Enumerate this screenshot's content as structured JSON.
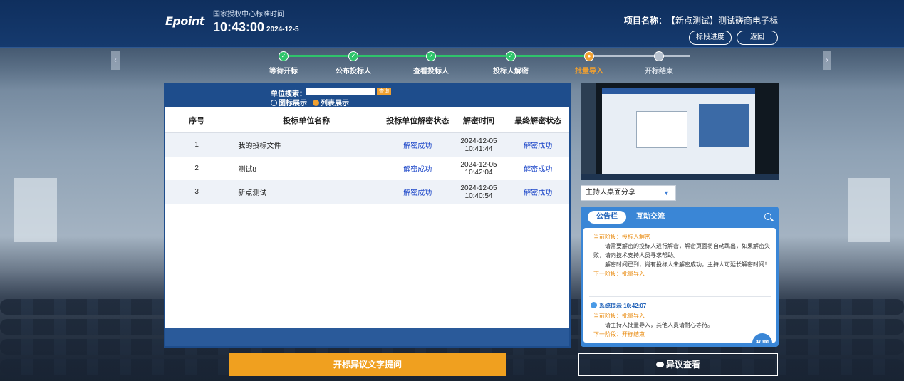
{
  "header": {
    "logo": "Epoint",
    "time_label": "国家授权中心标准时间",
    "time": "10:43:00",
    "date": "2024-12-5",
    "project_label": "项目名称：",
    "project_name": "【新点测试】测试磋商电子标",
    "btn_progress": "标段进度",
    "btn_back": "返回"
  },
  "steps": [
    {
      "label": "等待开标",
      "state": "done"
    },
    {
      "label": "公布投标人",
      "state": "done"
    },
    {
      "label": "查看投标人",
      "state": "done"
    },
    {
      "label": "投标人解密",
      "state": "done"
    },
    {
      "label": "批量导入",
      "state": "current"
    },
    {
      "label": "开标结束",
      "state": "pending"
    }
  ],
  "colors": {
    "done": "#2fc46b",
    "current": "#f0a030",
    "pending": "#b7c2cf"
  },
  "panel": {
    "search_label": "单位搜索：",
    "search_value": "",
    "search_btn": "查询",
    "radio_icon": "图标展示",
    "radio_list": "列表展示",
    "columns": [
      "序号",
      "投标单位名称",
      "投标单位解密状态",
      "解密时间",
      "最终解密状态"
    ],
    "rows": [
      {
        "no": "1",
        "name": "我的投标文件",
        "status": "解密成功",
        "date": "2024-12-05",
        "time": "10:41:44",
        "final": "解密成功"
      },
      {
        "no": "2",
        "name": "测试8",
        "status": "解密成功",
        "date": "2024-12-05",
        "time": "10:42:04",
        "final": "解密成功"
      },
      {
        "no": "3",
        "name": "新点测试",
        "status": "解密成功",
        "date": "2024-12-05",
        "time": "10:40:54",
        "final": "解密成功"
      }
    ]
  },
  "share_select": "主持人桌面分享",
  "notice": {
    "tab_active": "公告栏",
    "tab_other": "互动交流",
    "msg1_stage": "当前阶段：投标人解密",
    "msg1_body1": "请需要解密的投标人进行解密，解密页面将自动跳出，如果解密失败，请向技术支持人员寻求帮助。",
    "msg1_body2": "解密时间已到，尚有投标人未解密成功，主持人可延长解密时间！",
    "msg1_next": "下一阶段：批量导入",
    "msg2_title": "系统提示 10:42:07",
    "msg2_stage": "当前阶段：批量导入",
    "msg2_body": "请主持人批量导入，其他人员请耐心等待。",
    "msg2_next": "下一阶段：开标结束",
    "chat_btn": "私聊"
  },
  "buttons": {
    "objection_text": "开标异议文字提问",
    "objection_view": "异议查看"
  }
}
